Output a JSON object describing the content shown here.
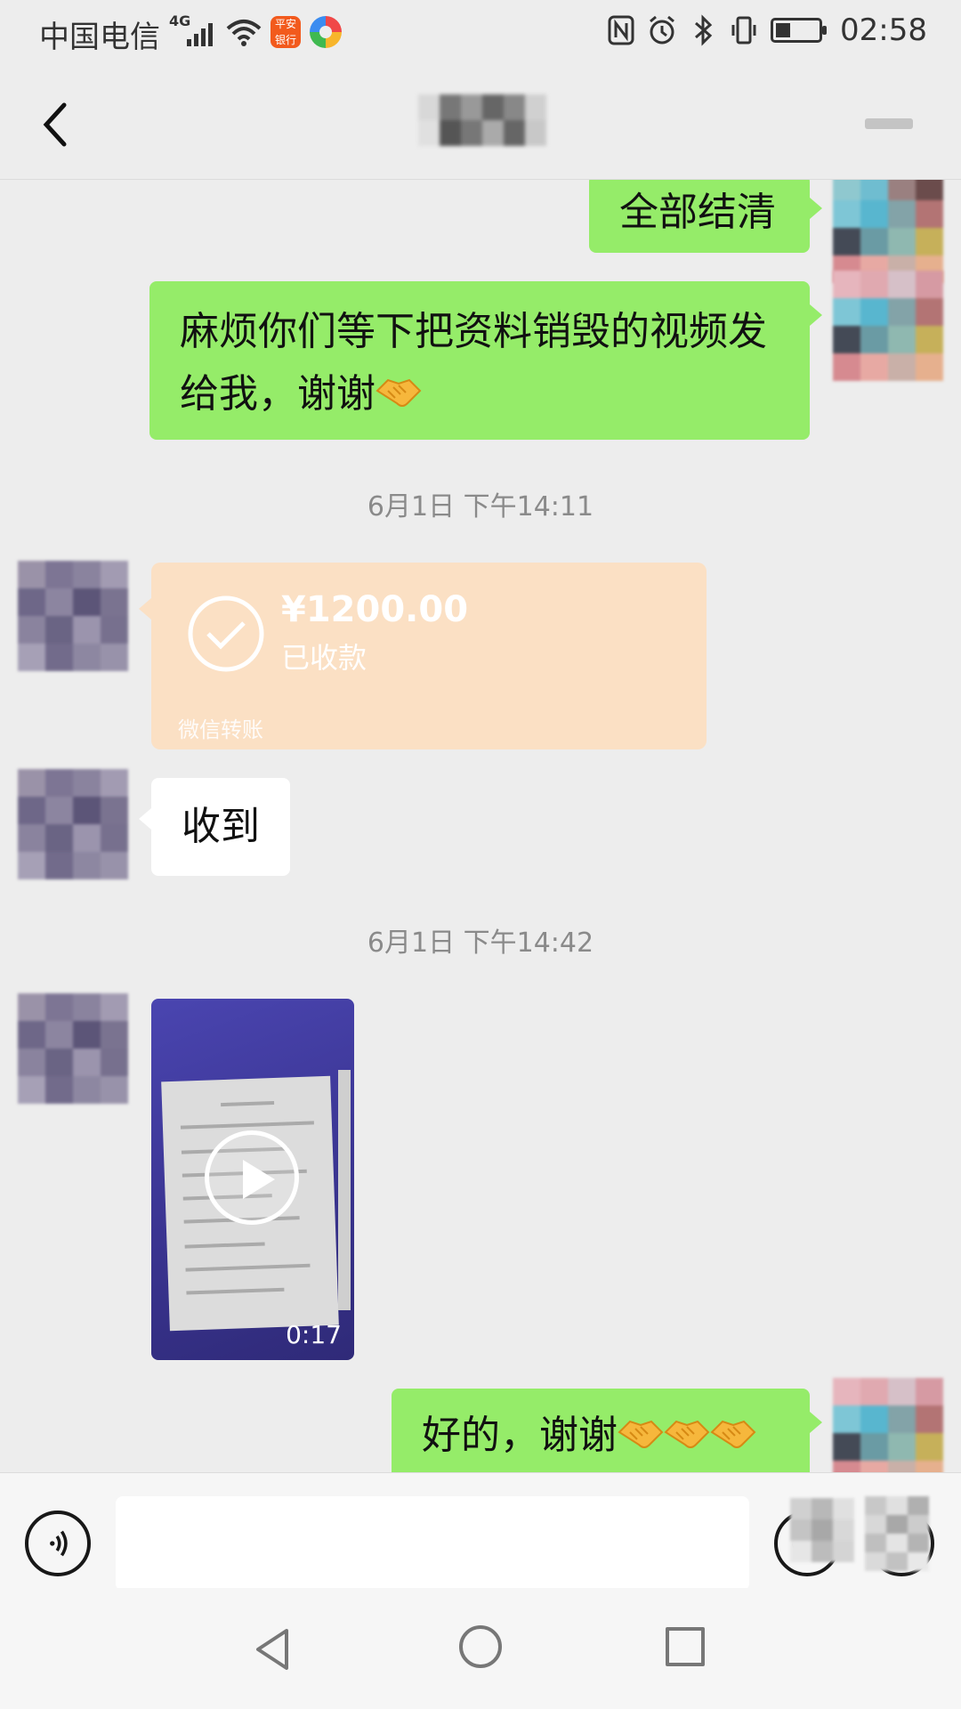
{
  "status_bar": {
    "carrier": "中国电信",
    "network": "4G",
    "app_badge": "平安银行",
    "time": "02:58",
    "icons": [
      "signal-icon",
      "wifi-icon",
      "nfc-icon",
      "alarm-icon",
      "bluetooth-icon",
      "vibrate-icon",
      "battery-charging-icon"
    ]
  },
  "header": {
    "back_icon": "chevron-left-icon",
    "more_icon": "more-icon"
  },
  "messages": [
    {
      "type": "text",
      "direction": "out",
      "text": "全部结清"
    },
    {
      "type": "text",
      "direction": "out",
      "line1": "麻烦你们等下把资料销毁的视频发",
      "line2": "给我，谢谢",
      "emoji": "handshake"
    },
    {
      "type": "timestamp",
      "text": "6月1日 下午14:11"
    },
    {
      "type": "transfer",
      "direction": "in",
      "amount": "¥1200.00",
      "status": "已收款",
      "footer": "微信转账"
    },
    {
      "type": "text",
      "direction": "in",
      "text": "收到"
    },
    {
      "type": "timestamp",
      "text": "6月1日 下午14:42"
    },
    {
      "type": "video",
      "direction": "in",
      "duration": "0:17"
    },
    {
      "type": "text",
      "direction": "out",
      "text": "好的，谢谢",
      "emoji": "handshake x3"
    }
  ],
  "input_bar": {
    "voice_icon": "voice-icon",
    "input_value": "",
    "emoji_icon": "emoji-icon",
    "plus_icon": "plus-icon"
  },
  "nav_bar": {
    "icons": [
      "nav-back-icon",
      "nav-home-icon",
      "nav-recent-icon"
    ]
  },
  "colors": {
    "background": "#ededed",
    "outgoing_bubble": "#95ec69",
    "incoming_bubble": "#ffffff",
    "transfer_card": "#fbe0c4",
    "timestamp_text": "#8a8a8a"
  }
}
